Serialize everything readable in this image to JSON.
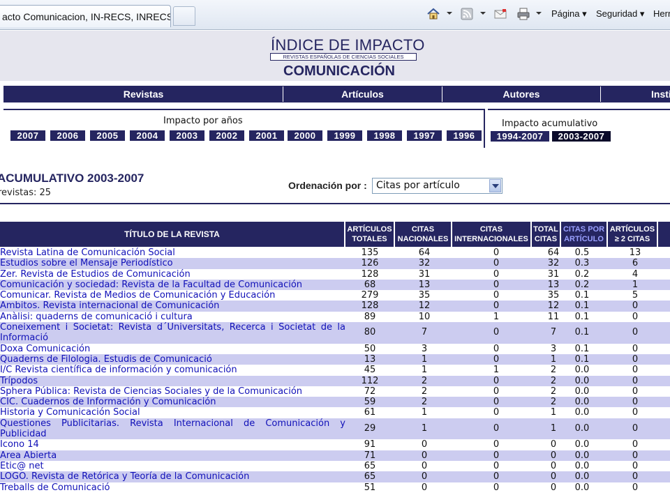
{
  "browser": {
    "tab_title": "acto Comunicacion, IN-RECS, INRECS",
    "commands": [
      "Página",
      "Seguridad",
      "Herr"
    ]
  },
  "header": {
    "title": "ÍNDICE DE IMPACTO",
    "subtitle": "REVISTAS ESPAÑOLAS DE CIENCIAS SOCIALES",
    "area": "COMUNICACIÓN"
  },
  "nav": [
    "Revistas",
    "Artículos",
    "Autores",
    "Insti"
  ],
  "years_label": "Impacto por años",
  "years": [
    "2007",
    "2006",
    "2005",
    "2004",
    "2003",
    "2002",
    "2001",
    "2000",
    "1999",
    "1998",
    "1997",
    "1996"
  ],
  "acum_label": "Impacto acumulativo",
  "acum_periods": [
    "1994-2007",
    "2003-2007"
  ],
  "section_title": "ACUMULATIVO 2003-2007",
  "count_text": "revistas: 25",
  "sort": {
    "label": "Ordenación por :",
    "value": "Citas por artículo"
  },
  "columns": [
    "Título de la revista",
    "Artículos totales",
    "Citas nacionales",
    "Citas internacionales",
    "Total citas",
    "Citas por artículo",
    "Artículos ≥ 2 citas"
  ],
  "rows": [
    {
      "title": "Revista Latina de Comunicación Social",
      "art": "135",
      "nac": "64",
      "int": "0",
      "tot": "64",
      "cpa": "0.5",
      "a2": "13"
    },
    {
      "title": "Estudios sobre el Mensaje Periodístico",
      "art": "126",
      "nac": "32",
      "int": "0",
      "tot": "32",
      "cpa": "0.3",
      "a2": "6"
    },
    {
      "title": "Zer. Revista de Estudios de Comunicación",
      "art": "128",
      "nac": "31",
      "int": "0",
      "tot": "31",
      "cpa": "0.2",
      "a2": "4"
    },
    {
      "title": "Comunicación y sociedad: Revista de la Facultad de Comunicación",
      "art": "68",
      "nac": "13",
      "int": "0",
      "tot": "13",
      "cpa": "0.2",
      "a2": "1"
    },
    {
      "title": "Comunicar. Revista de Medios de Comunicación y Educación",
      "art": "279",
      "nac": "35",
      "int": "0",
      "tot": "35",
      "cpa": "0.1",
      "a2": "5"
    },
    {
      "title": "Ambitos. Revista internacional de Comunicación",
      "art": "128",
      "nac": "12",
      "int": "0",
      "tot": "12",
      "cpa": "0.1",
      "a2": "0"
    },
    {
      "title": "Anàlisi: quaderns de comunicació i cultura",
      "art": "89",
      "nac": "10",
      "int": "1",
      "tot": "11",
      "cpa": "0.1",
      "a2": "0"
    },
    {
      "title": "Coneixement i Societat: Revista d´Universitats, Recerca i Societat de la Informació",
      "art": "80",
      "nac": "7",
      "int": "0",
      "tot": "7",
      "cpa": "0.1",
      "a2": "0"
    },
    {
      "title": "Doxa Comunicación",
      "art": "50",
      "nac": "3",
      "int": "0",
      "tot": "3",
      "cpa": "0.1",
      "a2": "0"
    },
    {
      "title": "Quaderns de Filologia. Estudis de Comunicació",
      "art": "13",
      "nac": "1",
      "int": "0",
      "tot": "1",
      "cpa": "0.1",
      "a2": "0"
    },
    {
      "title": "I/C Revista científica de información y comunicación",
      "art": "45",
      "nac": "1",
      "int": "1",
      "tot": "2",
      "cpa": "0.0",
      "a2": "0"
    },
    {
      "title": "Trípodos",
      "art": "112",
      "nac": "2",
      "int": "0",
      "tot": "2",
      "cpa": "0.0",
      "a2": "0"
    },
    {
      "title": "Sphera Pública: Revista de Ciencias Sociales y de la Comunicación",
      "art": "72",
      "nac": "2",
      "int": "0",
      "tot": "2",
      "cpa": "0.0",
      "a2": "0"
    },
    {
      "title": "CIC. Cuadernos de Información y Comunicación",
      "art": "59",
      "nac": "2",
      "int": "0",
      "tot": "2",
      "cpa": "0.0",
      "a2": "0"
    },
    {
      "title": "Historia y Comunicación Social",
      "art": "61",
      "nac": "1",
      "int": "0",
      "tot": "1",
      "cpa": "0.0",
      "a2": "0"
    },
    {
      "title": "Questiones Publicitarias. Revista Internacional de Comunicación y Publicidad",
      "art": "29",
      "nac": "1",
      "int": "0",
      "tot": "1",
      "cpa": "0.0",
      "a2": "0"
    },
    {
      "title": "Icono 14",
      "art": "91",
      "nac": "0",
      "int": "0",
      "tot": "0",
      "cpa": "0.0",
      "a2": "0"
    },
    {
      "title": "Area Abierta",
      "art": "71",
      "nac": "0",
      "int": "0",
      "tot": "0",
      "cpa": "0.0",
      "a2": "0"
    },
    {
      "title": "Etic@ net",
      "art": "65",
      "nac": "0",
      "int": "0",
      "tot": "0",
      "cpa": "0.0",
      "a2": "0"
    },
    {
      "title": "LOGO. Revista de Retórica y Teoría de la Comunicación",
      "art": "65",
      "nac": "0",
      "int": "0",
      "tot": "0",
      "cpa": "0.0",
      "a2": "0"
    },
    {
      "title": "Treballs de Comunicació",
      "art": "51",
      "nac": "0",
      "int": "0",
      "tot": "0",
      "cpa": "0.0",
      "a2": "0"
    }
  ]
}
